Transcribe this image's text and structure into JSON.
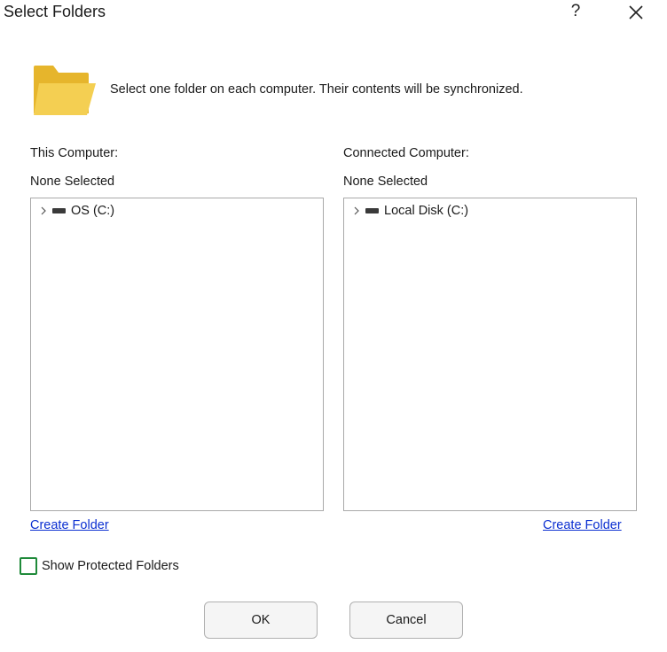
{
  "window": {
    "title": "Select Folders",
    "help_label": "?"
  },
  "intro_text": "Select one folder on each computer.  Their contents will be synchronized.",
  "left_panel": {
    "heading": "This Computer:",
    "selection": "None Selected",
    "tree_items": [
      {
        "label": "OS (C:)",
        "icon": "drive-icon",
        "expanded": false
      }
    ],
    "create_folder_label": "Create Folder"
  },
  "right_panel": {
    "heading": "Connected Computer:",
    "selection": "None Selected",
    "tree_items": [
      {
        "label": "Local Disk (C:)",
        "icon": "drive-icon",
        "expanded": false
      }
    ],
    "create_folder_label": "Create Folder"
  },
  "options": {
    "show_protected_label": "Show Protected Folders",
    "show_protected_checked": false
  },
  "buttons": {
    "ok_label": "OK",
    "cancel_label": "Cancel"
  },
  "colors": {
    "link": "#0b2fd1",
    "checkbox_border": "#1f8a3a",
    "folder_yellow": "#f2c63f"
  }
}
